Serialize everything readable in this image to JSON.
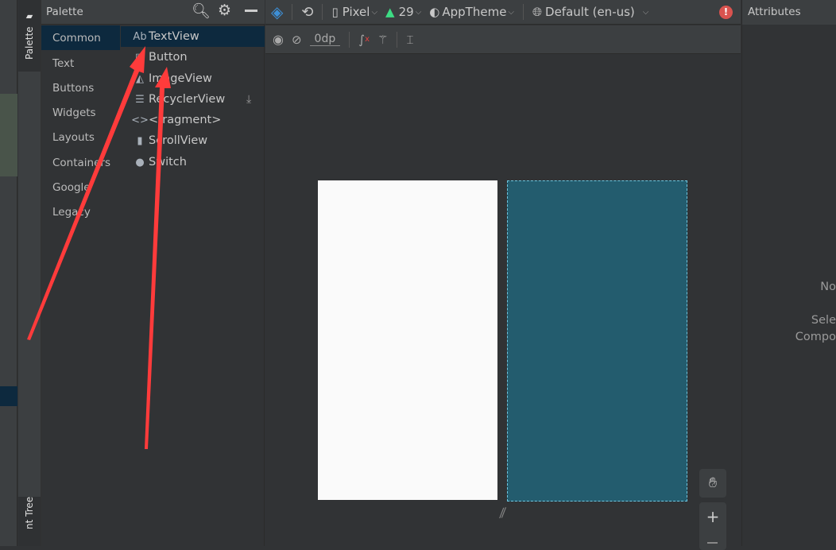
{
  "sidetabs": {
    "palette": "Palette",
    "component_tree": "nt Tree"
  },
  "palette": {
    "title": "Palette",
    "categories": [
      "Common",
      "Text",
      "Buttons",
      "Widgets",
      "Layouts",
      "Containers",
      "Google",
      "Legacy"
    ],
    "selected_category": "Common",
    "items": [
      {
        "icon": "Ab",
        "label": "TextView"
      },
      {
        "icon": "button-icon",
        "label": "Button"
      },
      {
        "icon": "image-icon",
        "label": "ImageView"
      },
      {
        "icon": "list-icon",
        "label": "RecyclerView"
      },
      {
        "icon": "code-icon",
        "label": "<fragment>"
      },
      {
        "icon": "scroll-icon",
        "label": "ScrollView"
      },
      {
        "icon": "switch-icon",
        "label": "Switch"
      }
    ]
  },
  "toolbar": {
    "device": "Pixel",
    "api": "29",
    "theme": "AppTheme",
    "locale": "Default (en-us)",
    "margin": "0dp"
  },
  "attributes": {
    "title": "Attributes",
    "line1": "No",
    "line2": "Sele",
    "line3": "Compo"
  },
  "colors": {
    "accent": "#0d293e",
    "blueprint": "#235c6e",
    "annotation": "#ff3b3b"
  }
}
